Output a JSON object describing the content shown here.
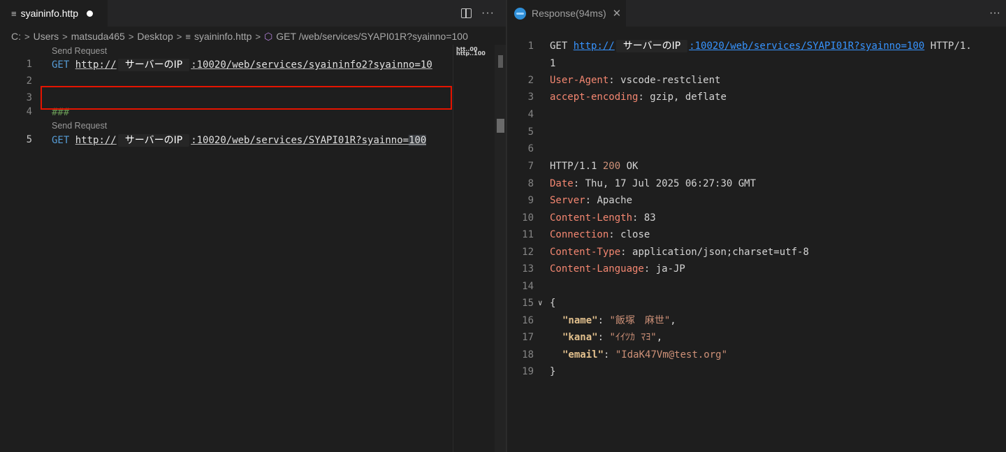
{
  "left": {
    "tab": {
      "label": "syaininfo.http"
    },
    "breadcrumb": [
      "C:",
      "Users",
      "matsuda465",
      "Desktop",
      "syaininfo.http",
      "GET /web/services/SYAPI01R?syainno=100"
    ],
    "codelens": "Send Request",
    "lines": {
      "l1": {
        "num": "1",
        "method": "GET",
        "scheme": "http://",
        "ip": "サーバーのIP",
        "rest": ":10020/web/services/syaininfo2?syainno=10"
      },
      "l2": {
        "num": "2"
      },
      "l3": {
        "num": "3"
      },
      "l4": {
        "num": "4",
        "text": "###"
      },
      "l5": {
        "num": "5",
        "method": "GET",
        "scheme": "http://",
        "ip": "サーバーのIP",
        "rest": ":10020/web/services/SYAPI01R?syainno=",
        "tail": "100"
      }
    },
    "minimap_text": "htt..00\nhttp..100"
  },
  "right": {
    "tab": {
      "label": "Response(94ms)"
    },
    "request": {
      "method": "GET",
      "scheme": "http://",
      "ip": "サーバーのIP",
      "rest": ":10020/web/services/SYAPI01R?syainno=100",
      "proto": " HTTP/1.",
      "wrap": "1"
    },
    "headers_req": [
      {
        "num": "2",
        "key": "User-Agent",
        "value": "vscode-restclient"
      },
      {
        "num": "3",
        "key": "accept-encoding",
        "value": "gzip, deflate"
      }
    ],
    "empty_lines": [
      "4",
      "5",
      "6"
    ],
    "status": {
      "num": "7",
      "proto": "HTTP/1.1",
      "code": "200",
      "text": "OK"
    },
    "headers_res": [
      {
        "num": "8",
        "key": "Date",
        "value": "Thu, 17 Jul 2025 06:27:30 GMT"
      },
      {
        "num": "9",
        "key": "Server",
        "value": "Apache"
      },
      {
        "num": "10",
        "key": "Content-Length",
        "value": "83"
      },
      {
        "num": "11",
        "key": "Connection",
        "value": "close"
      },
      {
        "num": "12",
        "key": "Content-Type",
        "value": "application/json;charset=utf-8"
      },
      {
        "num": "13",
        "key": "Content-Language",
        "value": "ja-JP"
      }
    ],
    "blank14": "14",
    "json_open": {
      "num": "15",
      "text": "{"
    },
    "json_fields": [
      {
        "num": "16",
        "key": "\"name\"",
        "value": "\"飯塚　麻世\"",
        "comma": ","
      },
      {
        "num": "17",
        "key": "\"kana\"",
        "value": "\"ｲｲﾂｶ ﾏﾖ\"",
        "comma": ","
      },
      {
        "num": "18",
        "key": "\"email\"",
        "value": "\"IdaK47Vm@test.org\"",
        "comma": ""
      }
    ],
    "json_close": {
      "num": "19",
      "text": "}"
    }
  }
}
